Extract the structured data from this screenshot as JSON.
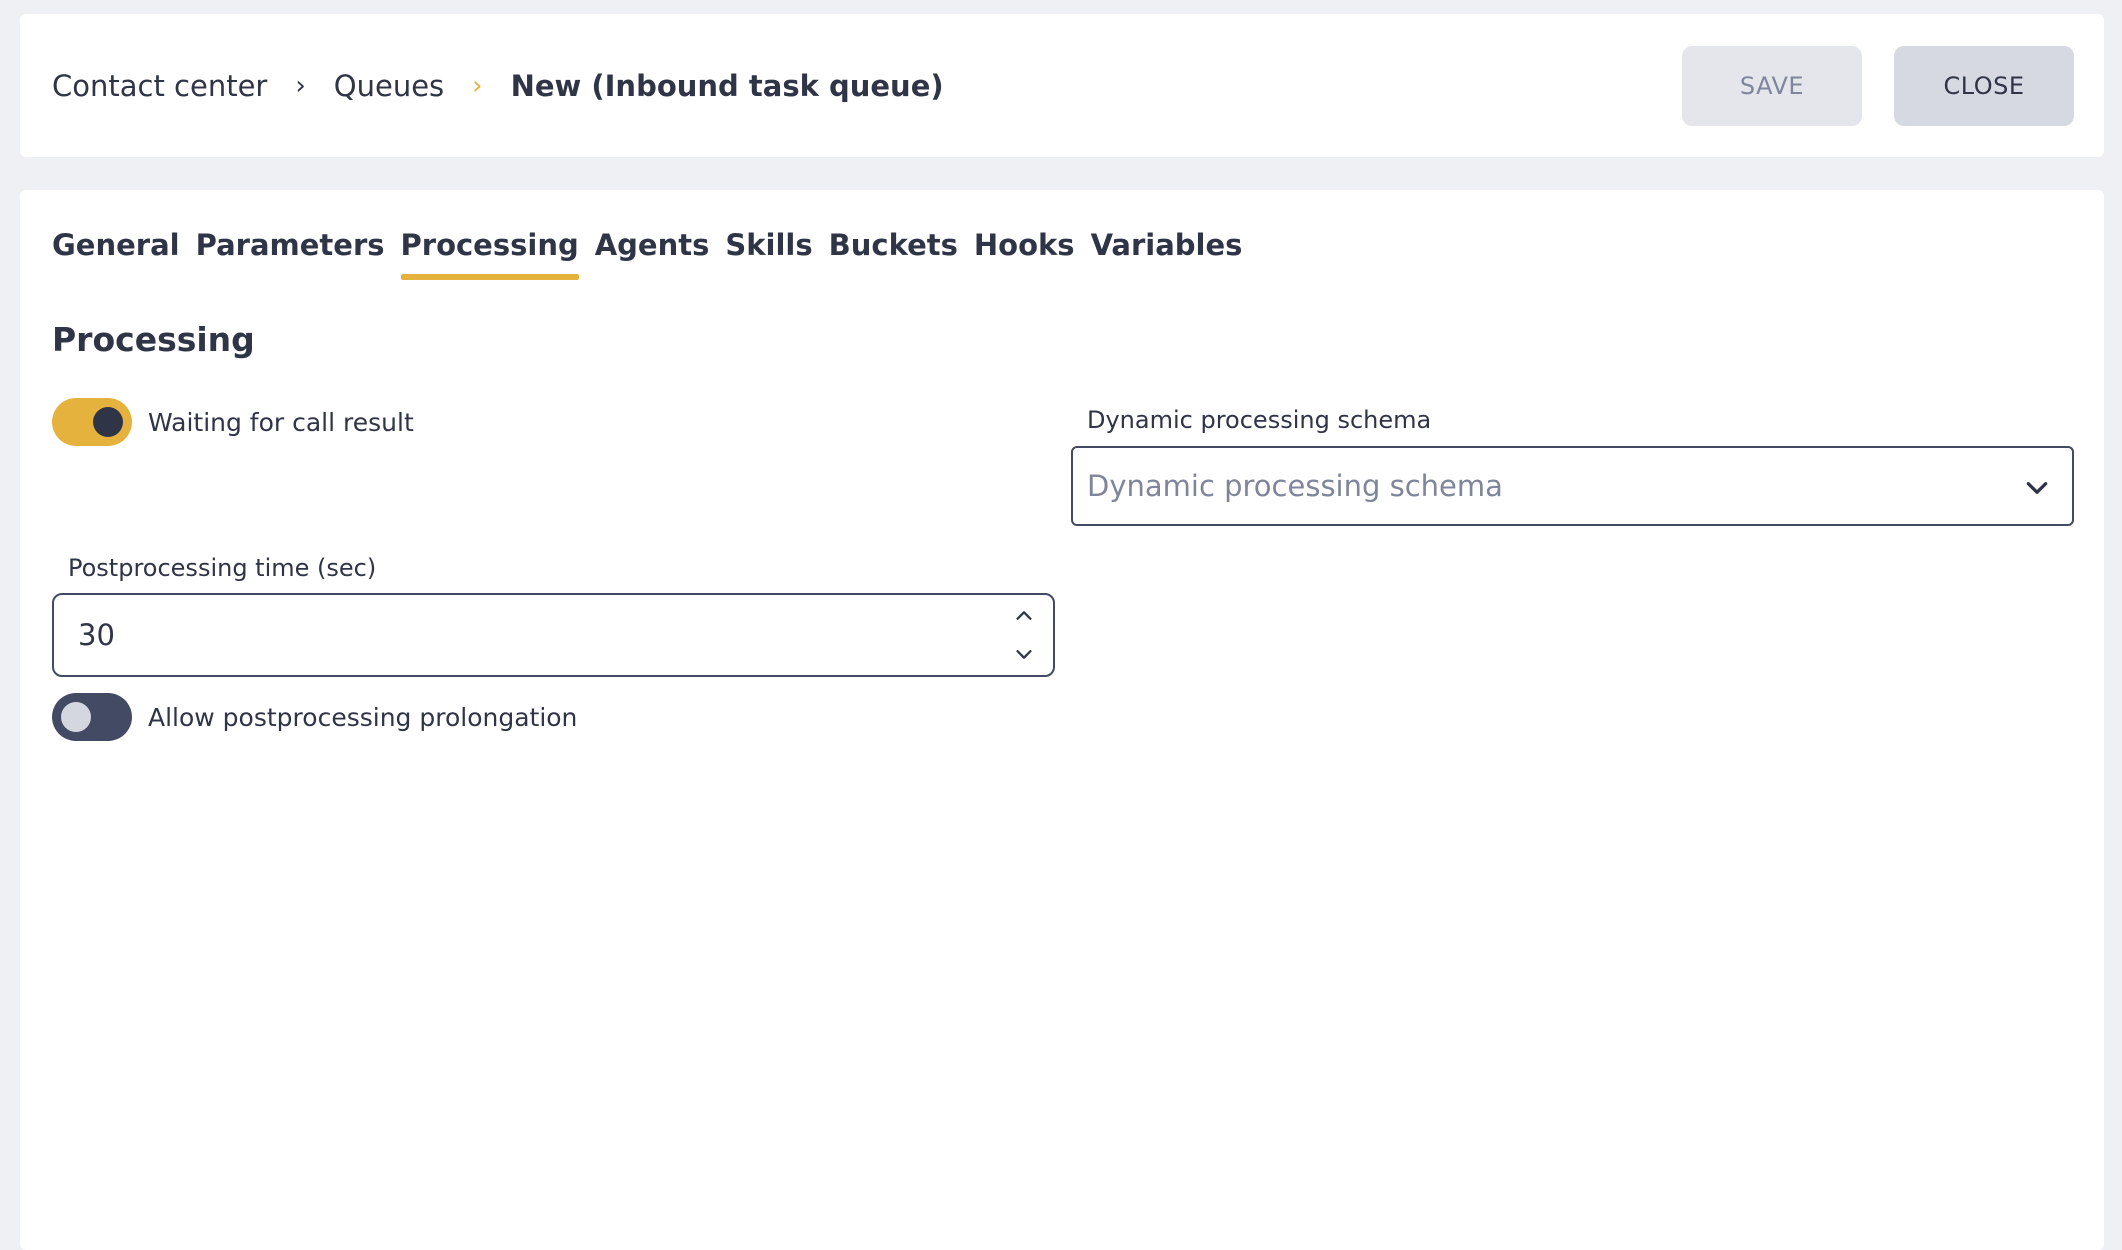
{
  "breadcrumb": {
    "items": [
      "Contact center",
      "Queues"
    ],
    "current": "New (Inbound task queue)",
    "separator": "›"
  },
  "header": {
    "save_label": "SAVE",
    "close_label": "CLOSE"
  },
  "tabs": [
    {
      "label": "General"
    },
    {
      "label": "Parameters"
    },
    {
      "label": "Processing",
      "active": true
    },
    {
      "label": "Agents"
    },
    {
      "label": "Skills"
    },
    {
      "label": "Buckets"
    },
    {
      "label": "Hooks"
    },
    {
      "label": "Variables"
    }
  ],
  "section": {
    "title": "Processing"
  },
  "fields": {
    "waiting_toggle": {
      "label": "Waiting for call result",
      "checked": true
    },
    "schema": {
      "label": "Dynamic processing schema",
      "placeholder": "Dynamic processing schema"
    },
    "postprocessing_time": {
      "label": "Postprocessing time (sec)",
      "value": "30"
    },
    "prolongation_toggle": {
      "label": "Allow postprocessing prolongation",
      "checked": false
    }
  },
  "colors": {
    "accent": "#e6b23e",
    "text": "#2f3447",
    "muted": "#7f869c",
    "background": "#eef0f4"
  }
}
